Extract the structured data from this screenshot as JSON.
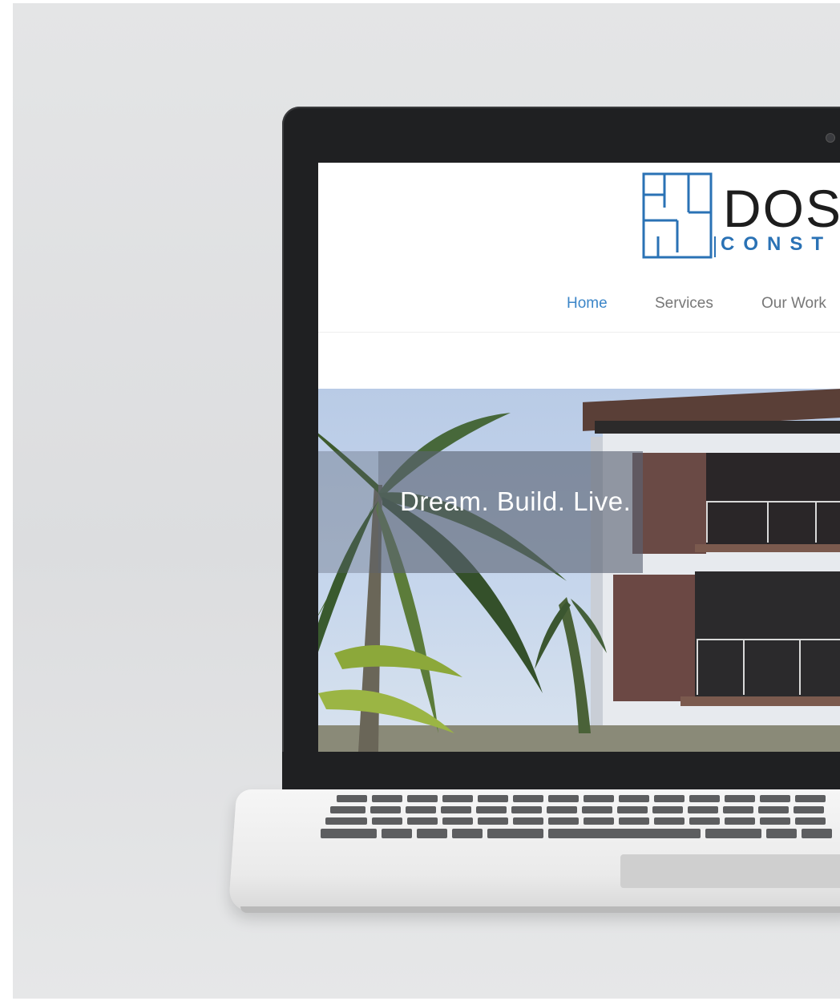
{
  "site": {
    "logo_title": "DOS",
    "logo_subtitle": "CONST"
  },
  "nav": {
    "items": [
      {
        "label": "Home",
        "active": true
      },
      {
        "label": "Services",
        "active": false
      },
      {
        "label": "Our Work",
        "active": false
      }
    ]
  },
  "hero": {
    "tagline": "Dream. Build. Live."
  },
  "colors": {
    "accent_blue": "#2a72b5",
    "nav_active": "#3c86c8",
    "nav_inactive": "#777777",
    "logo_dark": "#1d1d1d"
  },
  "icons": {
    "logo_mark": "floor-plan-logo-icon"
  }
}
